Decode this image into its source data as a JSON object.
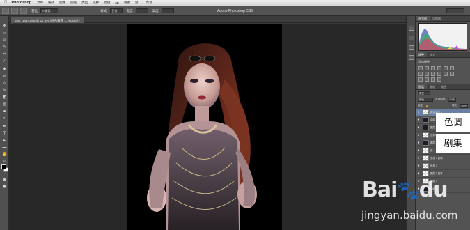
{
  "menubar": {
    "app_name": "Photoshop",
    "items": [
      "文件",
      "编辑",
      "图像",
      "图层",
      "类型",
      "选择",
      "滤镜",
      "3D",
      "视图",
      "窗口",
      "帮助"
    ]
  },
  "options": {
    "feather_label": "羽化:",
    "feather_value": "0 像素",
    "style_label": "样式:",
    "style_value": "正常",
    "width_label": "宽度:",
    "height_label": "高度:",
    "window_title": "Adobe Photoshop CS6"
  },
  "document": {
    "tab_label": "IMG_1444.psd @ 17.3% (颜色填充 1, RGB/8) *"
  },
  "panels": {
    "histogram_tabs": [
      "直方图",
      "导航器"
    ],
    "adjust_tabs": [
      "调整",
      "样式"
    ],
    "adjust_title": "添加调整",
    "layers_tabs": [
      "图层",
      "通道",
      "路径"
    ],
    "kind_label": "类型",
    "blend_mode": "颜色",
    "opacity_label": "不透明度:",
    "opacity_value": "100%",
    "lock_label": "锁定:",
    "fill_label": "填充:",
    "fill_value": "100%",
    "layers": [
      {
        "name": "颜色填充 1",
        "visible": true,
        "dark": false,
        "selected": true
      },
      {
        "name": "曲线 1",
        "visible": true,
        "dark": true,
        "selected": false
      },
      {
        "name": "图层 7",
        "visible": true,
        "dark": true,
        "selected": false
      },
      {
        "name": "色彩平衡 1",
        "visible": true,
        "dark": false,
        "selected": false
      },
      {
        "name": "图层 6",
        "visible": true,
        "dark": true,
        "selected": false
      },
      {
        "name": "组 1",
        "visible": true,
        "dark": false,
        "selected": false
      },
      {
        "name": "色相 1 副本",
        "visible": true,
        "dark": false,
        "selected": false
      },
      {
        "name": "色相 1",
        "visible": true,
        "dark": false,
        "selected": false
      },
      {
        "name": "图层 5 副本",
        "visible": true,
        "dark": false,
        "selected": false
      },
      {
        "name": "图层 5",
        "visible": true,
        "dark": false,
        "selected": false
      },
      {
        "name": "曲线 1",
        "visible": true,
        "dark": true,
        "selected": false
      }
    ]
  },
  "captions": {
    "first": "色调",
    "second": "剧集"
  },
  "watermark": {
    "brand": "Baidu",
    "url": "jingyan.baidu.com"
  },
  "colors": {
    "foreground": "#000000",
    "background": "#ffffff"
  }
}
